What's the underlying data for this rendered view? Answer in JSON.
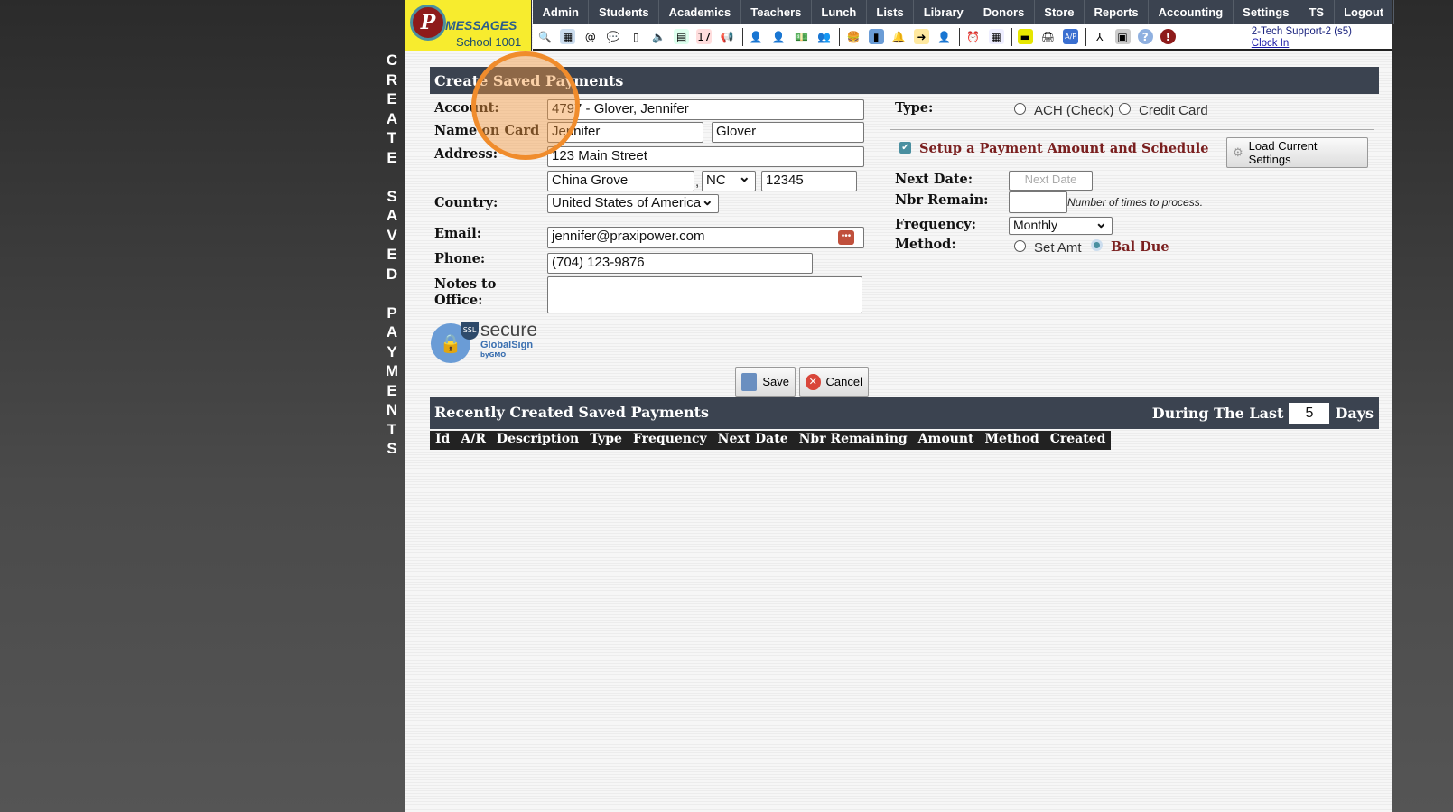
{
  "side_title": "CREATE SAVED PAYMENTS",
  "logo": {
    "brand": "MESSAGES",
    "school": "School 1001"
  },
  "nav": [
    "Admin",
    "Students",
    "Academics",
    "Teachers",
    "Lunch",
    "Lists",
    "Library",
    "Donors",
    "Store",
    "Reports",
    "Accounting",
    "Settings",
    "TS",
    "Logout"
  ],
  "toolbar_icons": [
    "search-icon",
    "calendar-grid-icon",
    "email-at-icon",
    "chat-icon",
    "mobile-phone-icon",
    "speaker-icon",
    "calendar-icon",
    "calendar-date-icon",
    "megaphone-icon",
    "add-person-icon",
    "person-icon",
    "money-icon",
    "people-icon",
    "burger-icon",
    "book-icon",
    "bell-icon",
    "export-icon",
    "staff-icon",
    "alarm-clock-icon",
    "spreadsheet-icon",
    "card-icon",
    "printer-icon",
    "ap-icon",
    "pdf-icon",
    "cash-register-icon",
    "help-icon",
    "power-icon"
  ],
  "user": {
    "name": "2-Tech Support-2 (s5)",
    "clock_in": "Clock In"
  },
  "form": {
    "title": "Create Saved Payments",
    "account_label": "Account:",
    "account_value": "4797 - Glover, Jennifer",
    "name_label": "Name on Card",
    "first_name": "Jennifer",
    "last_name": "Glover",
    "address_label": "Address:",
    "street": "123 Main Street",
    "city": "China Grove",
    "comma": ",",
    "state": "NC",
    "zip": "12345",
    "country_label": "Country:",
    "country": "United States of America",
    "email_label": "Email:",
    "email": "jennifer@praxipower.com",
    "phone_label": "Phone:",
    "phone": "(704) 123-9876",
    "notes_label_1": "Notes to",
    "notes_label_2": "Office:",
    "notes": "",
    "ssl": {
      "top": "SSL",
      "brand": "secure",
      "sub": "GlobalSign",
      "by": "byGMO"
    },
    "type_label": "Type:",
    "type_options": [
      "ACH (Check)",
      "Credit Card"
    ],
    "schedule_label": "Setup a Payment Amount and Schedule",
    "schedule_checked": true,
    "load_settings": "Load Current Settings",
    "next_date_label": "Next Date:",
    "next_date_placeholder": "Next Date",
    "nbr_label": "Nbr Remain:",
    "nbr_hint": "Number of times to process.",
    "freq_label": "Frequency:",
    "frequency": "Monthly",
    "method_label": "Method:",
    "method_options": [
      "Set Amt",
      "Bal Due"
    ],
    "method_selected": "Bal Due",
    "save": "Save",
    "cancel": "Cancel"
  },
  "recent": {
    "title": "Recently Created Saved Payments",
    "during": "During The Last",
    "days_value": "5",
    "days": "Days",
    "columns": [
      "Id",
      "A/R",
      "Description",
      "Type",
      "Frequency",
      "Next Date",
      "Nbr Remaining",
      "Amount",
      "Method",
      "Created"
    ]
  },
  "colors": {
    "nav_bg": "#3b4350",
    "logo_bg": "#f7ec2e",
    "accent_text": "#7a1f1f",
    "highlight": "#f08c2c"
  }
}
